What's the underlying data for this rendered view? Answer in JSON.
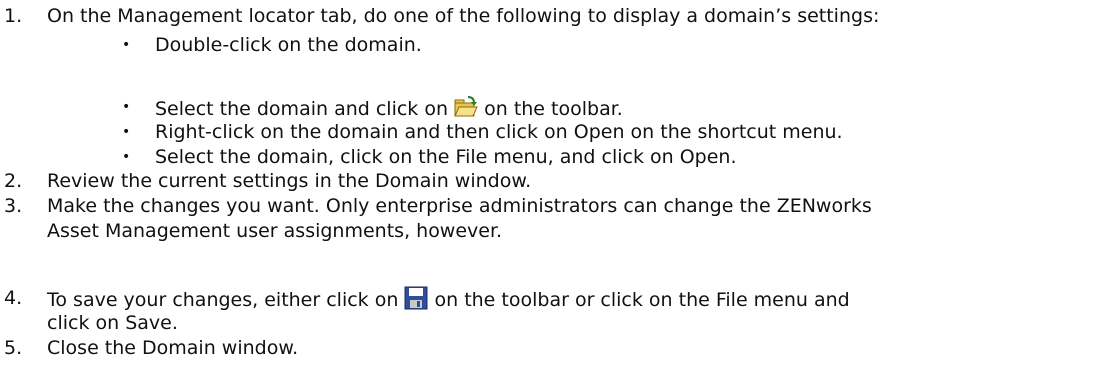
{
  "steps": [
    {
      "number": "1.",
      "text": "On the Management locator tab, do one of the following to display a domain’s settings:",
      "sub_items": [
        {
          "text": "Double-click on the domain."
        },
        {
          "text_before": "Select the domain and click on",
          "icon": "open-folder-icon",
          "text_after": "on the toolbar."
        },
        {
          "text": "Right-click on the domain and then click on Open on the shortcut menu."
        },
        {
          "text": "Select the domain, click on the File menu, and click on Open."
        }
      ]
    },
    {
      "number": "2.",
      "text": "Review the current settings in the Domain window."
    },
    {
      "number": "3.",
      "lines": [
        "Make the changes you want. Only enterprise administrators can change the ZENworks",
        "Asset Management user assignments, however."
      ]
    },
    {
      "number": "4.",
      "text_before": "To save your changes, either click on",
      "icon": "save-disk-icon",
      "text_after": "on the toolbar or click on the File menu and",
      "text_continued": "click on Save."
    },
    {
      "number": "5.",
      "text": "Close the Domain window."
    }
  ],
  "bullet_glyph": "•",
  "icon_colors": {
    "folder": "#e8c84a",
    "folder_dark": "#8a6d10",
    "disk": "#2f4f9a",
    "disk_label": "#ffffff"
  }
}
